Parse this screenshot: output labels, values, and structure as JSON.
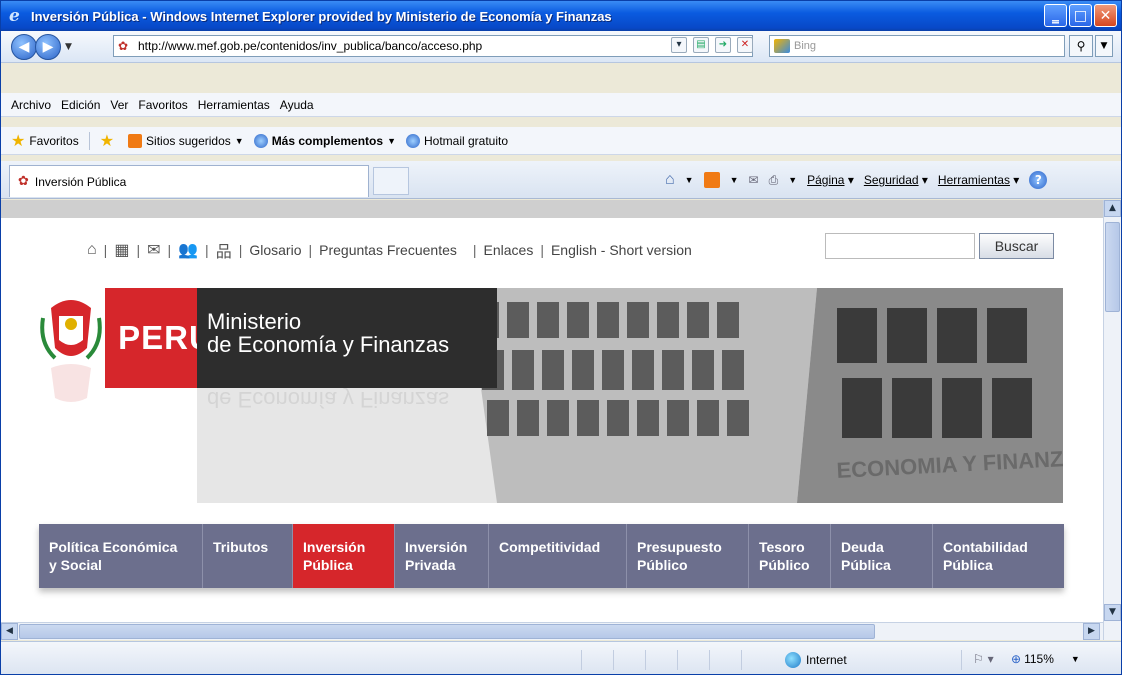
{
  "window": {
    "title": "Inversión Pública - Windows Internet Explorer provided by Ministerio de Economía y Finanzas",
    "min": "‗",
    "max": "□",
    "close": "✕"
  },
  "address": {
    "url": "http://www.mef.gob.pe/contenidos/inv_publica/banco/acceso.php",
    "search_placeholder": "Bing"
  },
  "menu": [
    "Archivo",
    "Edición",
    "Ver",
    "Favoritos",
    "Herramientas",
    "Ayuda"
  ],
  "favorites": {
    "favoritos": "Favoritos",
    "sitios": "Sitios sugeridos",
    "complementos": "Más complementos",
    "hotmail": "Hotmail gratuito"
  },
  "tab": {
    "label": "Inversión Pública"
  },
  "commandbar": {
    "pagina": "Página",
    "seguridad": "Seguridad",
    "herramientas": "Herramientas"
  },
  "page": {
    "topnav": [
      "Glosario",
      "Preguntas Frecuentes",
      "Enlaces",
      "English - Short version"
    ],
    "search_button": "Buscar",
    "peru": "PERÚ",
    "ministerio_l1": "Ministerio",
    "ministerio_l2": "de Economía y Finanzas",
    "ministerio_reflect": "de Economía y Finanzas",
    "facade_text": "ECONOMIA Y FINANZAS",
    "nav": [
      {
        "l1": "Política Económica",
        "l2": "y Social"
      },
      {
        "l1": "Tributos",
        "l2": ""
      },
      {
        "l1": "Inversión",
        "l2": "Pública"
      },
      {
        "l1": "Inversión",
        "l2": "Privada"
      },
      {
        "l1": "Competitividad",
        "l2": ""
      },
      {
        "l1": "Presupuesto",
        "l2": "Público"
      },
      {
        "l1": "Tesoro",
        "l2": "Público"
      },
      {
        "l1": "Deuda",
        "l2": "Pública"
      },
      {
        "l1": "Contabilidad",
        "l2": "Pública"
      }
    ]
  },
  "status": {
    "zone": "Internet",
    "zoom": "115%"
  },
  "colors": {
    "accent_red": "#d6262b",
    "nav_bg": "#6c6f8d",
    "titlebar": "#0a5be0"
  }
}
